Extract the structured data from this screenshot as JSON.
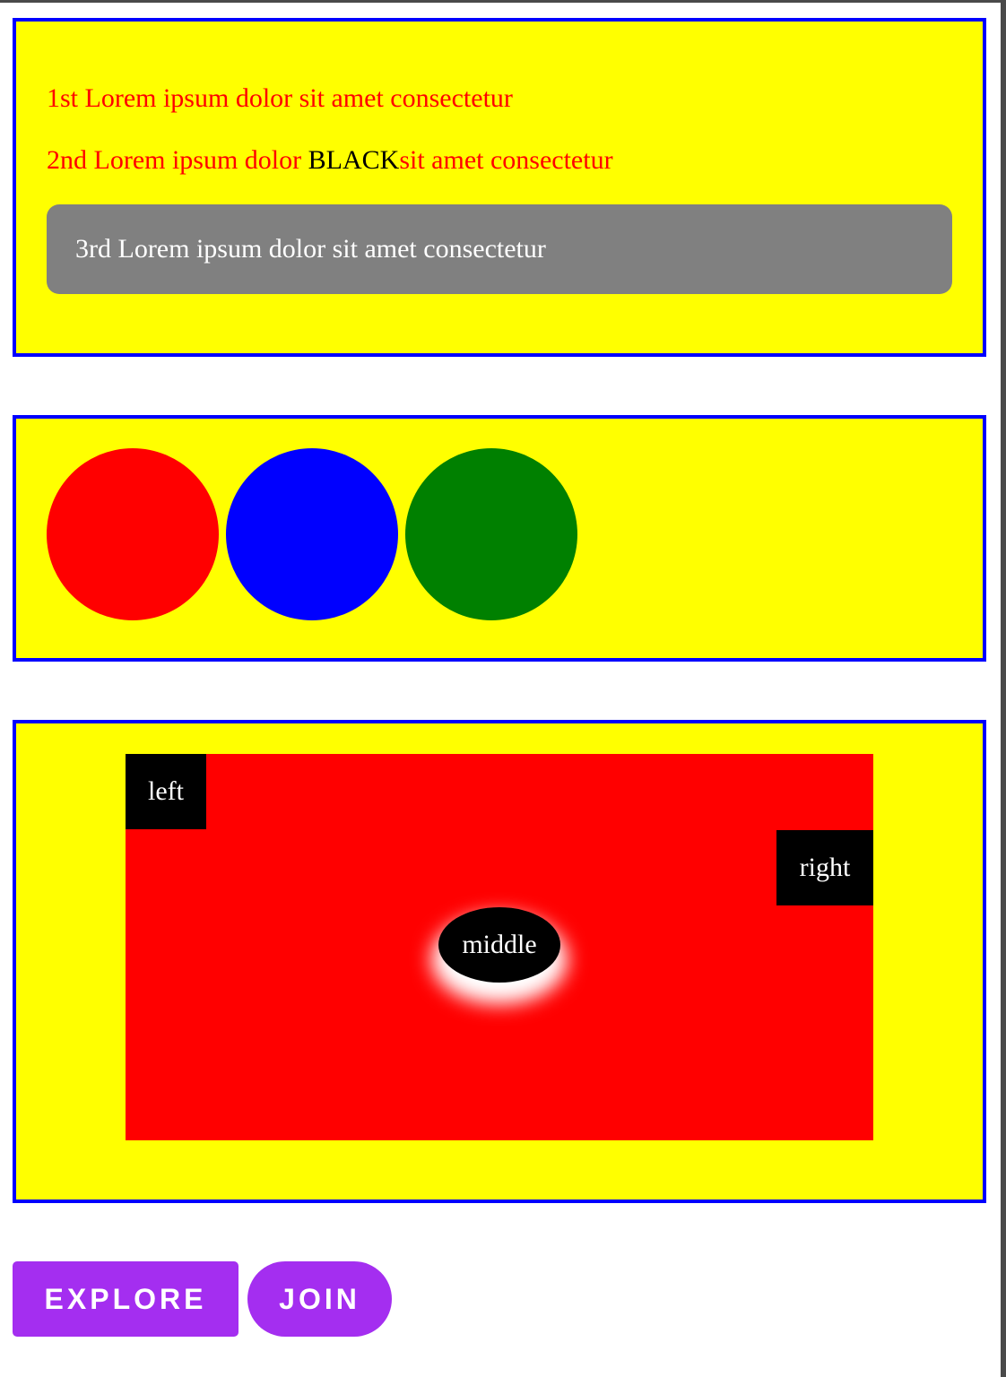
{
  "text_panel": {
    "line1": "1st Lorem ipsum dolor sit amet consectetur",
    "line2_part1": "2nd Lorem ipsum dolor ",
    "line2_black": "BLACK",
    "line2_part2": "sit amet consectetur",
    "line3": "3rd Lorem ipsum dolor sit amet consectetur"
  },
  "circles_panel": {
    "circles": [
      {
        "color": "#ff0000"
      },
      {
        "color": "#0000ff"
      },
      {
        "color": "#008000"
      }
    ]
  },
  "position_panel": {
    "left_label": "left",
    "right_label": "right",
    "middle_label": "middle"
  },
  "buttons": {
    "explore_label": "EXPLORE",
    "join_label": "JOIN"
  },
  "colors": {
    "panel_background": "#ffff00",
    "panel_border": "#0000ff",
    "text_red": "#ff0000",
    "gray_box": "#808080",
    "button_purple": "#a42ef0"
  }
}
